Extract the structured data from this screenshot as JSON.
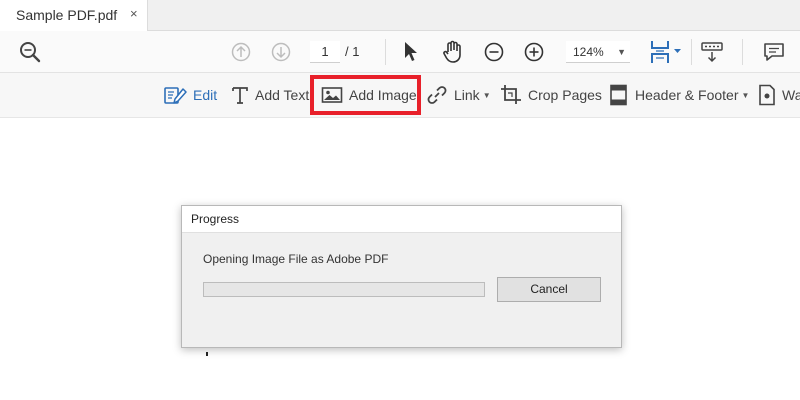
{
  "tab": {
    "title": "Sample PDF.pdf",
    "close_glyph": "×"
  },
  "toolbar": {
    "page_current": "1",
    "page_total": "/ 1",
    "zoom": "124%",
    "icons": [
      "search-icon",
      "page-up-icon",
      "page-down-icon",
      "select-cursor-icon",
      "hand-icon",
      "zoom-out-icon",
      "zoom-in-icon",
      "page-fit-icon",
      "keyboard-icon",
      "comment-icon"
    ]
  },
  "edit_tools": {
    "edit": "Edit",
    "add_text": "Add Text",
    "add_image": "Add Image",
    "link": "Link",
    "crop_pages": "Crop Pages",
    "header_footer": "Header & Footer",
    "watermark": "Wa"
  },
  "dialog": {
    "title": "Progress",
    "message": "Opening Image File as Adobe PDF",
    "progress": 0,
    "cancel_label": "Cancel"
  },
  "colors": {
    "accent": "#2d6fb8",
    "highlight": "#e8202a",
    "progress": "#06b025"
  }
}
